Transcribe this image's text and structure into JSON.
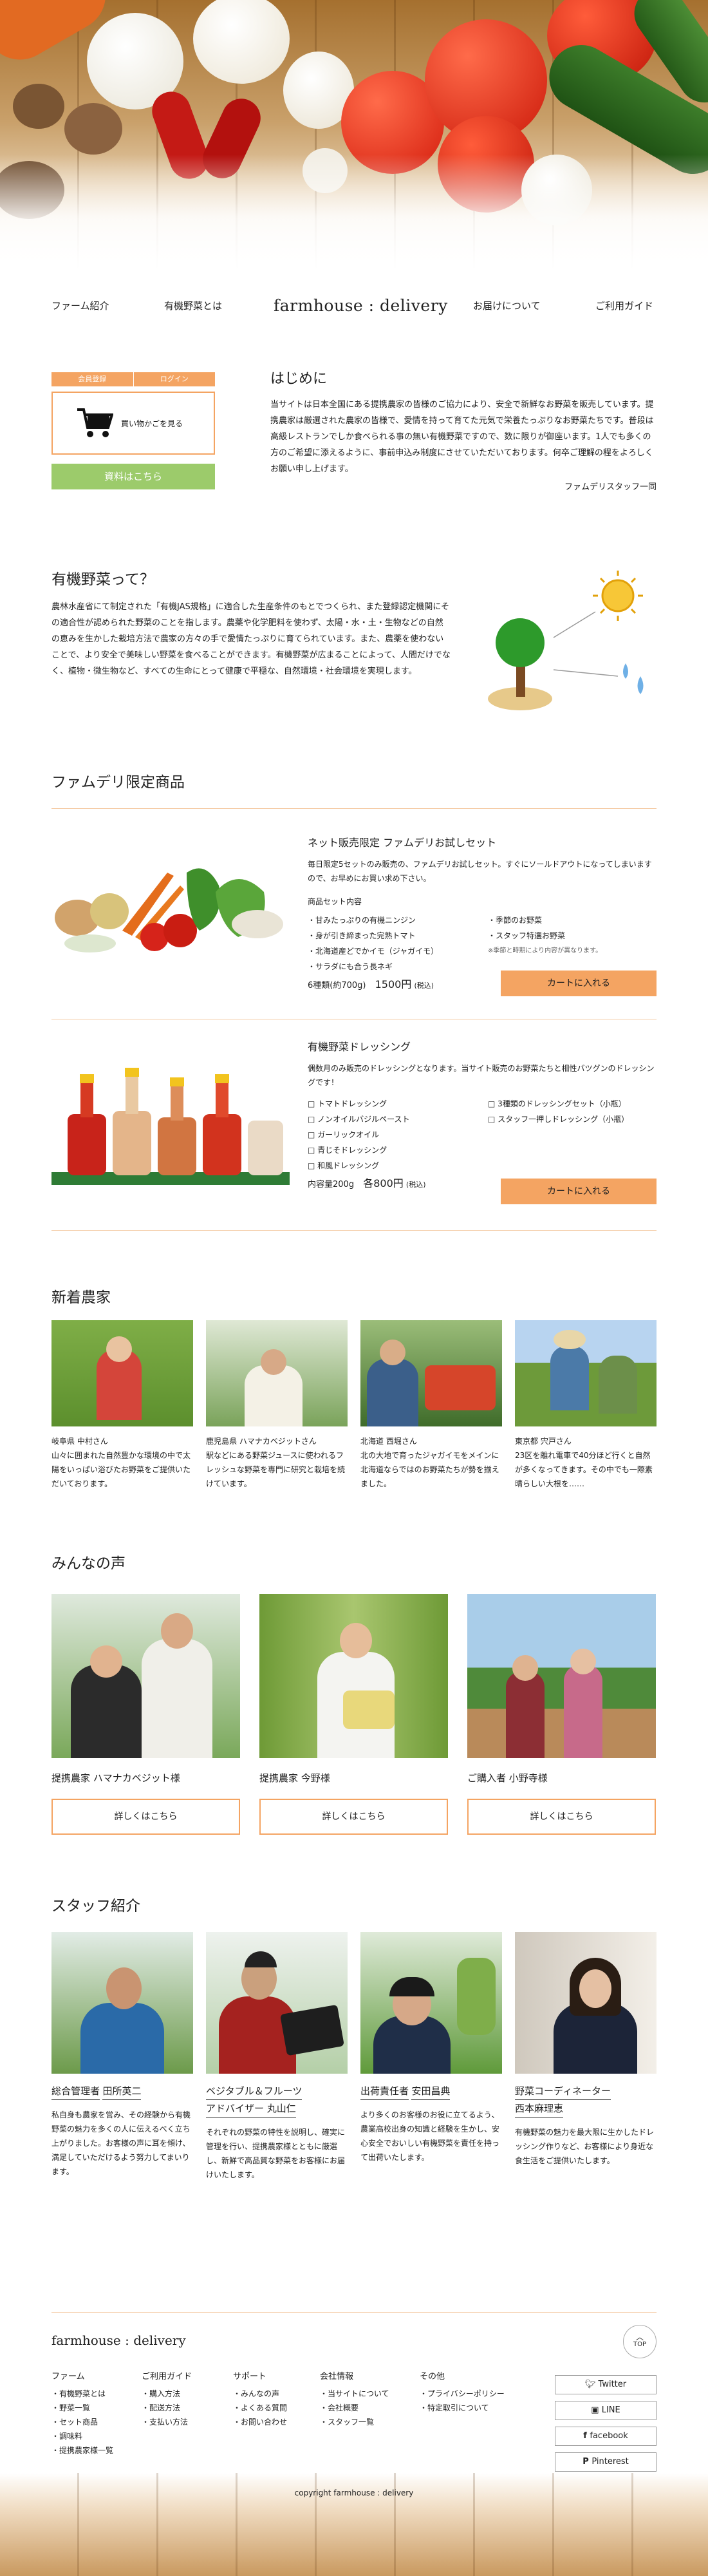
{
  "nav": {
    "items": [
      "ファーム紹介",
      "有機野菜とは",
      "お届けについて",
      "ご利用ガイド"
    ],
    "logo": "farmhouse : delivery"
  },
  "login": {
    "register": "会員登録",
    "login": "ログイン",
    "cart": "買い物かごを見る",
    "docs": "資料はこちら"
  },
  "intro": {
    "title": "はじめに",
    "body": "当サイトは日本全国にある提携農家の皆様のご協力により、安全で新鮮なお野菜を販売しています。提携農家は厳選された農家の皆様で、愛情を持って育てた元気で栄養たっぷりなお野菜たちです。普段は高級レストランでしか食べられる事の無い有機野菜ですので、数に限りが御座います。1人でも多くの方のご希望に添えるように、事前申込み制度にさせていただいております。何卒ご理解の程をよろしくお願い申し上げます。",
    "sign": "ファムデリスタッフ一同"
  },
  "organic": {
    "title": "有機野菜って？",
    "body": "農林水産省にて制定された「有機JAS規格」に適合した生産条件のもとでつくられ、また登録認定機関にその適合性が認められた野菜のことを指します。農薬や化学肥料を使わず、太陽・水・土・生物などの自然の恵みを生かした栽培方法で農家の方々の手で愛情たっぷりに育てられています。また、農薬を使わないことで、より安全で美味しい野菜を食べることができます。有機野菜が広まることによって、人間だけでなく、植物・微生物など、すべての生命にとって健康で平穏な、自然環境・社会環境を実現します。"
  },
  "limited": {
    "title": "ファムデリ限定商品",
    "p1": {
      "title": "ネット販売限定 ファムデリお試しセット",
      "desc": "毎日限定5セットのみ販売の、ファムデリお試しセット。すぐにソールドアウトになってしまいますので、お早めにお買い求め下さい。",
      "subtitle": "商品セット内容",
      "items_left": [
        "・甘みたっぷりの有機ニンジン",
        "・身が引き締まった完熟トマト",
        "・北海道産どでかイモ（ジャガイモ）",
        "・サラダにも合う長ネギ"
      ],
      "items_right": [
        "・季節のお野菜",
        "・スタッフ特選お野菜",
        "※季節と時期により内容が異なります。"
      ],
      "spec": "6種類(約700g)",
      "price": "1500円",
      "tax": "(税込)",
      "cta": "カートに入れる"
    },
    "p2": {
      "title": "有機野菜ドレッシング",
      "desc": "偶数月のみ販売のドレッシングとなります。当サイト販売のお野菜たちと相性バツグンのドレッシングです！",
      "items_left": [
        "□ トマトドレッシング",
        "□ ノンオイルバジルペースト",
        "□ ガーリックオイル",
        "□ 青じそドレッシング",
        "□ 和風ドレッシング"
      ],
      "items_right": [
        "□ 3種類のドレッシングセット（小瓶）",
        "□ スタッフ一押しドレッシング（小瓶）"
      ],
      "spec": "内容量200g",
      "price": "各800円",
      "tax": "(税込)",
      "cta": "カートに入れる"
    }
  },
  "farmers": {
    "title": "新着農家",
    "items": [
      {
        "name": "岐阜県 中村さん",
        "text": "山々に囲まれた自然豊かな環境の中で太陽をいっぱい浴びたお野菜をご提供いただいております。"
      },
      {
        "name": "鹿児島県 ハマナカベジットさん",
        "text": "駅などにある野菜ジュースに使われるフレッシュな野菜を専門に研究と栽培を続けています。"
      },
      {
        "name": "北海道 西堀さん",
        "text": "北の大地で育ったジャガイモをメインに北海道ならではのお野菜たちが勢を揃えました。"
      },
      {
        "name": "東京都 宍戸さん",
        "text": "23区を離れ電車で40分ほど行くと自然が多くなってきます。その中でも一際素晴らしい大根を……"
      }
    ]
  },
  "voices": {
    "title": "みんなの声",
    "items": [
      {
        "name": "提携農家 ハマナカベジット様",
        "more": "詳しくはこちら"
      },
      {
        "name": "提携農家 今野様",
        "more": "詳しくはこちら"
      },
      {
        "name": "ご購入者 小野寺様",
        "more": "詳しくはこちら"
      }
    ]
  },
  "staff": {
    "title": "スタッフ紹介",
    "items": [
      {
        "role": "総合管理者",
        "name": "田所英二",
        "text": "私自身も農家を営み、その経験から有機野菜の魅力を多くの人に伝えるべく立ち上がりました。お客様の声に耳を傾け、満足していただけるよう努力してまいります。"
      },
      {
        "role": "ベジタブル＆フルーツ",
        "name": "アドバイザー 丸山仁",
        "text": "それぞれの野菜の特性を説明し、確実に管理を行い、提携農家様とともに厳選し、新鮮で高品質な野菜をお客様にお届けいたします。"
      },
      {
        "role": "出荷責任者",
        "name": "安田昌典",
        "text": "より多くのお客様のお役に立てるよう、農業高校出身の知識と経験を生かし、安心安全でおいしい有機野菜を責任を持って出荷いたします。"
      },
      {
        "role": "野菜コーディネーター",
        "name": "西本麻理恵",
        "text": "有機野菜の魅力を最大限に生かしたドレッシング作りなど、お客様により身近な食生活をご提供いたします。"
      }
    ]
  },
  "footer": {
    "logo": "farmhouse : delivery",
    "top": "TOP",
    "cols": [
      {
        "title": "ファーム",
        "items": [
          "・有機野菜とは",
          "・野菜一覧",
          "・セット商品",
          "・調味料",
          "・提携農家様一覧"
        ]
      },
      {
        "title": "ご利用ガイド",
        "items": [
          "・購入方法",
          "・配送方法",
          "・支払い方法"
        ]
      },
      {
        "title": "サポート",
        "items": [
          "・みんなの声",
          "・よくある質問",
          "・お問い合わせ"
        ]
      },
      {
        "title": "会社情報",
        "items": [
          "・当サイトについて",
          "・会社概要",
          "・スタッフ一覧"
        ]
      },
      {
        "title": "その他",
        "items": [
          "・プライバシーポリシー",
          "・特定取引について"
        ]
      }
    ],
    "social": [
      "Twitter",
      "LINE",
      "facebook",
      "Pinterest"
    ],
    "copyright": "copyright farmhouse : delivery"
  },
  "colors": {
    "accent": "#f4a462",
    "green": "#9ccb6b"
  }
}
